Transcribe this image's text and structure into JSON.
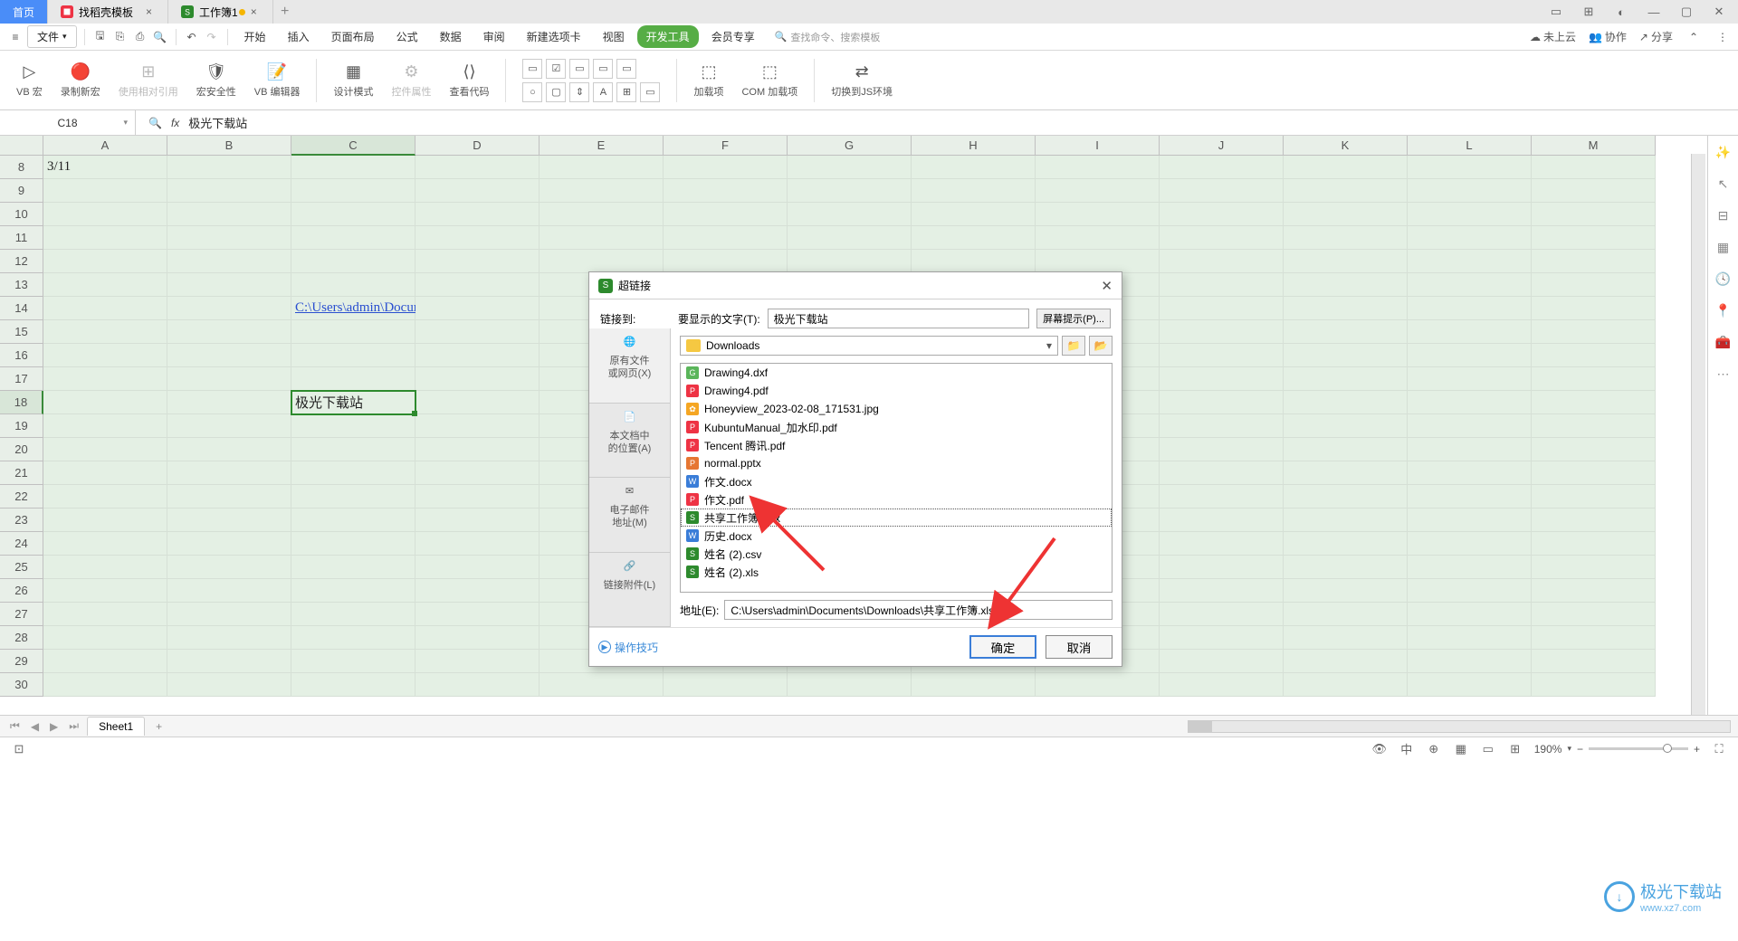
{
  "titlebar": {
    "tabs": [
      {
        "label": "首页",
        "active": true
      },
      {
        "label": "找稻壳模板",
        "active": false
      },
      {
        "label": "工作簿1",
        "active": false,
        "modified": true
      }
    ]
  },
  "menubar": {
    "file": "文件",
    "tabs": [
      "开始",
      "插入",
      "页面布局",
      "公式",
      "数据",
      "审阅",
      "新建选项卡",
      "视图",
      "开发工具",
      "会员专享"
    ],
    "active_tab": "开发工具",
    "search_placeholder": "查找命令、搜索模板",
    "right": {
      "cloud": "未上云",
      "collab": "协作",
      "share": "分享"
    }
  },
  "ribbon": {
    "items": [
      "VB 宏",
      "录制新宏",
      "使用相对引用",
      "宏安全性",
      "VB 编辑器",
      "设计模式",
      "控件属性",
      "查看代码",
      "加载项",
      "COM 加载项",
      "切换到JS环境"
    ]
  },
  "formula": {
    "cell_ref": "C18",
    "content": "极光下载站"
  },
  "columns": [
    "A",
    "B",
    "C",
    "D",
    "E",
    "F",
    "G",
    "H",
    "I",
    "J",
    "K",
    "L",
    "M"
  ],
  "rows_start": 8,
  "rows_end": 30,
  "selected_col": "C",
  "selected_row": 18,
  "cells": {
    "A8": "3/11",
    "C14": "C:\\Users\\admin\\Documen",
    "C18": "极光下载站"
  },
  "sheet_tab": "Sheet1",
  "statusbar": {
    "zoom": "190%"
  },
  "dialog": {
    "title": "超链接",
    "link_to_label": "链接到:",
    "display_label": "要显示的文字(T):",
    "display_value": "极光下载站",
    "screentip": "屏幕提示(P)...",
    "left_tabs": [
      {
        "l1": "原有文件",
        "l2": "或网页(X)"
      },
      {
        "l1": "本文档中",
        "l2": "的位置(A)"
      },
      {
        "l1": "电子邮件",
        "l2": "地址(M)"
      },
      {
        "l1": "链接附件(L)",
        "l2": ""
      }
    ],
    "folder": "Downloads",
    "files": [
      {
        "name": "Drawing4.dxf",
        "type": "gen"
      },
      {
        "name": "Drawing4.pdf",
        "type": "pdf"
      },
      {
        "name": "Honeyview_2023-02-08_171531.jpg",
        "type": "img"
      },
      {
        "name": "KubuntuManual_加水印.pdf",
        "type": "pdf"
      },
      {
        "name": "Tencent 腾讯.pdf",
        "type": "pdf"
      },
      {
        "name": "normal.pptx",
        "type": "ppt"
      },
      {
        "name": "作文.docx",
        "type": "doc"
      },
      {
        "name": "作文.pdf",
        "type": "pdf"
      },
      {
        "name": "共享工作簿.xlsx",
        "type": "xls",
        "selected": true
      },
      {
        "name": "历史.docx",
        "type": "doc"
      },
      {
        "name": "姓名 (2).csv",
        "type": "csv"
      },
      {
        "name": "姓名 (2).xls",
        "type": "xls"
      }
    ],
    "addr_label": "地址(E):",
    "addr_value": "C:\\Users\\admin\\Documents\\Downloads\\共享工作簿.xlsx",
    "tips": "操作技巧",
    "ok": "确定",
    "cancel": "取消"
  },
  "watermark": {
    "text": "极光下载站",
    "sub": "www.xz7.com"
  }
}
